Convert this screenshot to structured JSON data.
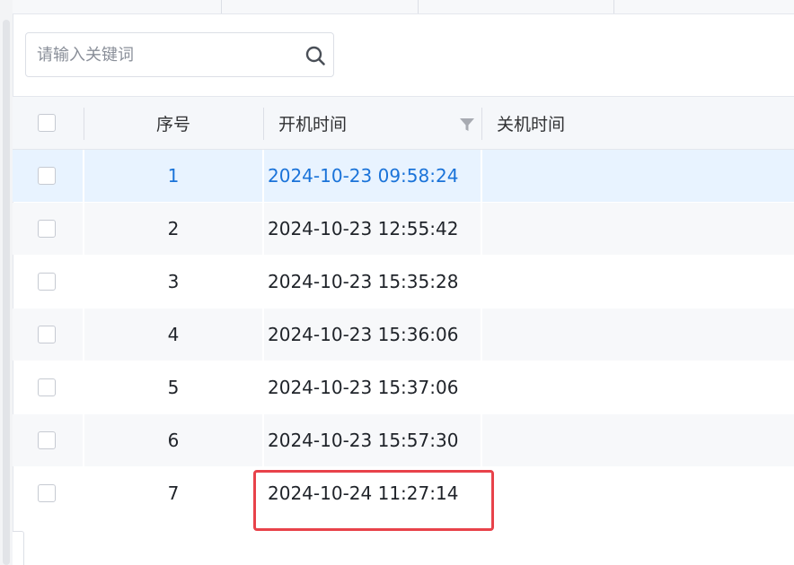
{
  "search": {
    "placeholder": "请输入关键词",
    "icon": "search-icon"
  },
  "table": {
    "columns": {
      "index": "序号",
      "power_on_time": "开机时间",
      "power_off_time": "关机时间"
    },
    "filter_icon": "filter-icon",
    "rows": [
      {
        "index": "1",
        "power_on_time": "2024-10-23 09:58:24",
        "power_off_time": "",
        "selected": true
      },
      {
        "index": "2",
        "power_on_time": "2024-10-23 12:55:42",
        "power_off_time": ""
      },
      {
        "index": "3",
        "power_on_time": "2024-10-23 15:35:28",
        "power_off_time": ""
      },
      {
        "index": "4",
        "power_on_time": "2024-10-23 15:36:06",
        "power_off_time": ""
      },
      {
        "index": "5",
        "power_on_time": "2024-10-23 15:37:06",
        "power_off_time": ""
      },
      {
        "index": "6",
        "power_on_time": "2024-10-23 15:57:30",
        "power_off_time": ""
      },
      {
        "index": "7",
        "power_on_time": "2024-10-24 11:27:14",
        "power_off_time": "",
        "highlighted": true
      }
    ]
  },
  "colors": {
    "selected_row_bg": "#e8f3ff",
    "selected_text": "#1a73d9",
    "highlight_border": "#e8424a",
    "header_bg": "#f5f7fa"
  }
}
